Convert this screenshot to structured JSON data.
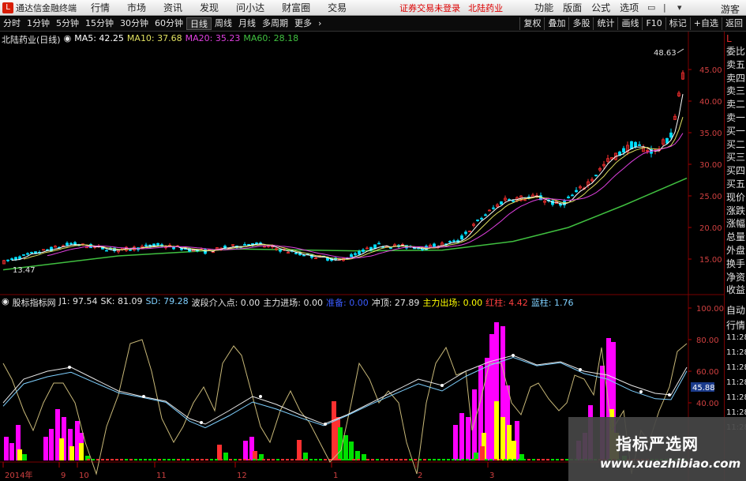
{
  "menubar": {
    "app_title": "通达信金融终端",
    "items": [
      "行情",
      "市场",
      "资讯",
      "发现",
      "问小达",
      "财富圈",
      "交易"
    ],
    "login_warning": "证券交易未登录",
    "stock_name": "北陆药业",
    "right_items": [
      "功能",
      "版面",
      "公式",
      "选项"
    ],
    "guest": "游客"
  },
  "toolbar": {
    "periods": [
      "分时",
      "1分钟",
      "5分钟",
      "15分钟",
      "30分钟",
      "60分钟",
      "日线",
      "周线",
      "月线",
      "多周期",
      "更多"
    ],
    "active_period": "日线",
    "right_buttons": [
      "复权",
      "叠加",
      "多股",
      "统计",
      "画线",
      "F10",
      "标记",
      "+自选",
      "返回"
    ]
  },
  "main_legend": {
    "title": "北陆药业(日线)",
    "ma5": "MA5: 42.25",
    "ma10": "MA10: 37.68",
    "ma20": "MA20: 35.23",
    "ma60": "MA60: 28.18"
  },
  "sub_legend": {
    "title": "股标指标网",
    "items": [
      {
        "text": "J1: 97.54",
        "color": "#e6e6e6"
      },
      {
        "text": "SK: 81.09",
        "color": "#e6e6e6"
      },
      {
        "text": "SD: 79.28",
        "color": "#7fd0ff"
      },
      {
        "text": "波段介入点: 0.00",
        "color": "#e6e6e6"
      },
      {
        "text": "主力进场: 0.00",
        "color": "#e6e6e6"
      },
      {
        "text": "准备: 0.00",
        "color": "#3a5bff"
      },
      {
        "text": "冲顶: 27.89",
        "color": "#e6e6e6"
      },
      {
        "text": "主力出场: 0.00",
        "color": "#ffff00"
      },
      {
        "text": "红柱: 4.42",
        "color": "#ff4040"
      },
      {
        "text": "蓝柱: 1.76",
        "color": "#7fd0ff"
      }
    ]
  },
  "price_axis": [
    "45.00",
    "40.00",
    "35.00",
    "30.00",
    "25.00",
    "20.00",
    "15.00"
  ],
  "indicator_axis": [
    "100.00",
    "80.00",
    "60.00",
    "40.00"
  ],
  "high_label": "48.63",
  "low_label": "13.47",
  "current_value_tag": "45.88",
  "date_axis": [
    "2014年",
    "9",
    "10",
    "11",
    "12",
    "1",
    "2",
    "3"
  ],
  "side_panel": [
    "委比",
    "卖五",
    "卖四",
    "卖三",
    "卖二",
    "卖一",
    "买一",
    "买二",
    "买三",
    "买四",
    "买五",
    "现价",
    "涨跌",
    "涨幅",
    "总量",
    "外盘",
    "换手",
    "净资",
    "收益"
  ],
  "side_panel_lower": [
    "自动",
    "行情",
    "11:28",
    "11:28",
    "11:28",
    "11:28",
    "11:28",
    "11:28",
    "11:28"
  ],
  "watermark": {
    "cn": "指标严选网",
    "url": "www.xuezhibiao.com"
  },
  "colors": {
    "up": "#ff3030",
    "down": "#00e0ff",
    "ma5": "#ffffff",
    "ma10": "#e0e060",
    "ma20": "#e040e0",
    "ma60": "#40c040",
    "magenta": "#ff00ff",
    "yellow": "#ffff00",
    "green": "#00e000"
  }
}
